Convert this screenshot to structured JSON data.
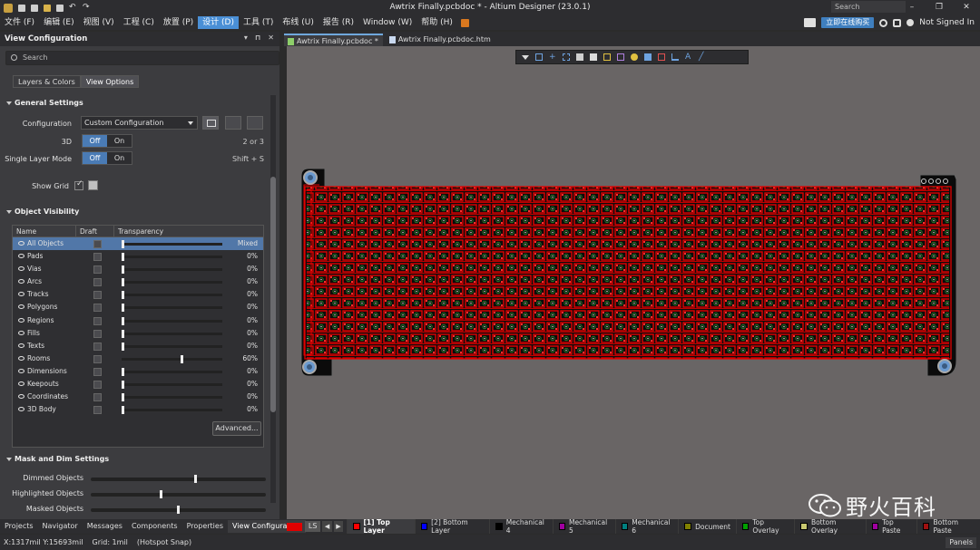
{
  "window": {
    "title": "Awtrix Finally.pcbdoc * - Altium Designer (23.0.1)",
    "search_placeholder": "Search"
  },
  "menu": {
    "items": [
      "文件 (F)",
      "编辑 (E)",
      "视图 (V)",
      "工程 (C)",
      "放置 (P)",
      "设计 (D)",
      "工具 (T)",
      "布线 (U)",
      "报告 (R)",
      "Window (W)",
      "帮助 (H)"
    ],
    "active_index": 5,
    "buy_label": "立即在线购买",
    "signed_label": "Not Signed In"
  },
  "panel": {
    "title": "View Configuration",
    "search_placeholder": "Search",
    "tabs": [
      "Layers & Colors",
      "View Options"
    ],
    "active_tab": 1,
    "general_settings": {
      "heading": "General Settings",
      "configuration_label": "Configuration",
      "configuration_value": "Custom Configuration",
      "three_d_label": "3D",
      "three_d_hint": "2 or 3",
      "single_layer_label": "Single Layer Mode",
      "single_layer_hint": "Shift + S",
      "toggle_off": "Off",
      "toggle_on": "On",
      "show_grid_label": "Show Grid"
    },
    "object_visibility": {
      "heading": "Object Visibility",
      "columns": [
        "Name",
        "Draft",
        "Transparency"
      ],
      "rows": [
        {
          "name": "All Objects",
          "value": "Mixed",
          "transparency": 0
        },
        {
          "name": "Pads",
          "value": "0%",
          "transparency": 0
        },
        {
          "name": "Vias",
          "value": "0%",
          "transparency": 0
        },
        {
          "name": "Arcs",
          "value": "0%",
          "transparency": 0
        },
        {
          "name": "Tracks",
          "value": "0%",
          "transparency": 0
        },
        {
          "name": "Polygons",
          "value": "0%",
          "transparency": 0
        },
        {
          "name": "Regions",
          "value": "0%",
          "transparency": 0
        },
        {
          "name": "Fills",
          "value": "0%",
          "transparency": 0
        },
        {
          "name": "Texts",
          "value": "0%",
          "transparency": 0
        },
        {
          "name": "Rooms",
          "value": "60%",
          "transparency": 60
        },
        {
          "name": "Dimensions",
          "value": "0%",
          "transparency": 0
        },
        {
          "name": "Keepouts",
          "value": "0%",
          "transparency": 0
        },
        {
          "name": "Coordinates",
          "value": "0%",
          "transparency": 0
        },
        {
          "name": "3D Body",
          "value": "0%",
          "transparency": 0
        }
      ],
      "advanced_label": "Advanced..."
    },
    "mask_dim": {
      "heading": "Mask and Dim Settings",
      "rows": [
        {
          "label": "Dimmed Objects",
          "level": 0.6
        },
        {
          "label": "Highlighted Objects",
          "level": 0.4
        },
        {
          "label": "Masked Objects",
          "level": 0.5
        }
      ]
    }
  },
  "documents": {
    "tabs": [
      "Awtrix Finally.pcbdoc *",
      "Awtrix Finally.pcbdoc.htm"
    ],
    "active_tab": 0
  },
  "bottom_tabs": [
    "Projects",
    "Navigator",
    "Messages",
    "Components",
    "Properties",
    "View Configuration"
  ],
  "bottom_active": 5,
  "layer_bar": {
    "ls_label": "LS",
    "layers": [
      {
        "name": "[1] Top Layer",
        "color": "#ff0000",
        "active": true
      },
      {
        "name": "[2] Bottom Layer",
        "color": "#0000ff",
        "active": false
      },
      {
        "name": "Mechanical 4",
        "color": "#000000",
        "active": false
      },
      {
        "name": "Mechanical 5",
        "color": "#a000a0",
        "active": false
      },
      {
        "name": "Mechanical 6",
        "color": "#008080",
        "active": false
      },
      {
        "name": "Document",
        "color": "#808000",
        "active": false
      },
      {
        "name": "Top Overlay",
        "color": "#00a000",
        "active": false
      },
      {
        "name": "Bottom Overlay",
        "color": "#c8c870",
        "active": false
      },
      {
        "name": "Top Paste",
        "color": "#a000a0",
        "active": false
      },
      {
        "name": "Bottom Paste",
        "color": "#a01010",
        "active": false
      }
    ]
  },
  "status": {
    "coords": "X:1317mil Y:15693mil",
    "grid": "Grid: 1mil",
    "snap": "(Hotspot Snap)",
    "panels_label": "Panels"
  },
  "watermark": {
    "text": "野火百科"
  },
  "colors": {
    "accent": "#4a8fd6",
    "board_red": "#e00000",
    "board_bg": "#0b0b0b"
  }
}
